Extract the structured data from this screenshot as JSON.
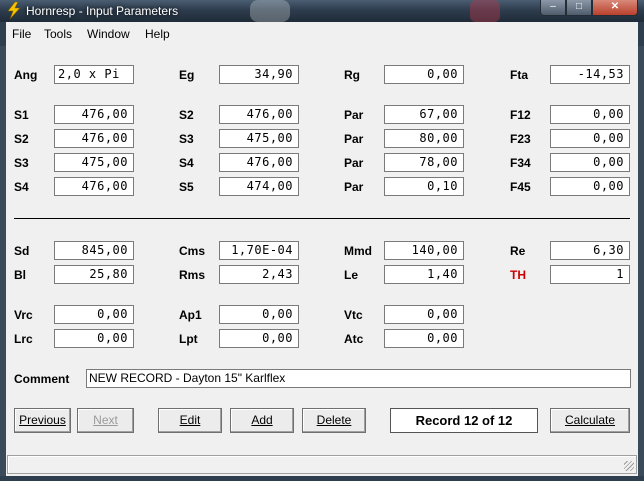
{
  "window": {
    "title": "Hornresp - Input Parameters",
    "controls": {
      "minimize": "–",
      "maximize": "□",
      "close": "✕"
    }
  },
  "menu": [
    "File",
    "Tools",
    "Window",
    "Help"
  ],
  "params": {
    "ang_label": "Ang",
    "ang_value": "2,0 x Pi",
    "eg_label": "Eg",
    "eg_value": "34,90",
    "rg_label": "Rg",
    "rg_value": "0,00",
    "fta_label": "Fta",
    "fta_value": "-14,53",
    "s1_label": "S1",
    "s1_value": "476,00",
    "s2_label": "S2",
    "s2_value": "476,00",
    "par1_label": "Par",
    "par1_value": "67,00",
    "f12_label": "F12",
    "f12_value": "0,00",
    "s2b_label": "S2",
    "s2b_value": "476,00",
    "s3_label": "S3",
    "s3_value": "475,00",
    "par2_label": "Par",
    "par2_value": "80,00",
    "f23_label": "F23",
    "f23_value": "0,00",
    "s3b_label": "S3",
    "s3b_value": "475,00",
    "s4_label": "S4",
    "s4_value": "476,00",
    "par3_label": "Par",
    "par3_value": "78,00",
    "f34_label": "F34",
    "f34_value": "0,00",
    "s4b_label": "S4",
    "s4b_value": "476,00",
    "s5_label": "S5",
    "s5_value": "474,00",
    "par4_label": "Par",
    "par4_value": "0,10",
    "f45_label": "F45",
    "f45_value": "0,00",
    "sd_label": "Sd",
    "sd_value": "845,00",
    "cms_label": "Cms",
    "cms_value": "1,70E-04",
    "mmd_label": "Mmd",
    "mmd_value": "140,00",
    "re_label": "Re",
    "re_value": "6,30",
    "bl_label": "Bl",
    "bl_value": "25,80",
    "rms_label": "Rms",
    "rms_value": "2,43",
    "le_label": "Le",
    "le_value": "1,40",
    "th_label": "TH",
    "th_value": "1",
    "vrc_label": "Vrc",
    "vrc_value": "0,00",
    "ap1_label": "Ap1",
    "ap1_value": "0,00",
    "vtc_label": "Vtc",
    "vtc_value": "0,00",
    "lrc_label": "Lrc",
    "lrc_value": "0,00",
    "lpt_label": "Lpt",
    "lpt_value": "0,00",
    "atc_label": "Atc",
    "atc_value": "0,00"
  },
  "comment": {
    "label": "Comment",
    "value": "NEW RECORD - Dayton 15\" Karlflex"
  },
  "buttons": {
    "previous": "Previous",
    "next": "Next",
    "edit": "Edit",
    "add": "Add",
    "delete": "Delete",
    "calculate": "Calculate"
  },
  "record": "Record 12 of 12",
  "colors": {
    "th_label": "#cc0000",
    "titlebar": "#2e3d4e"
  }
}
